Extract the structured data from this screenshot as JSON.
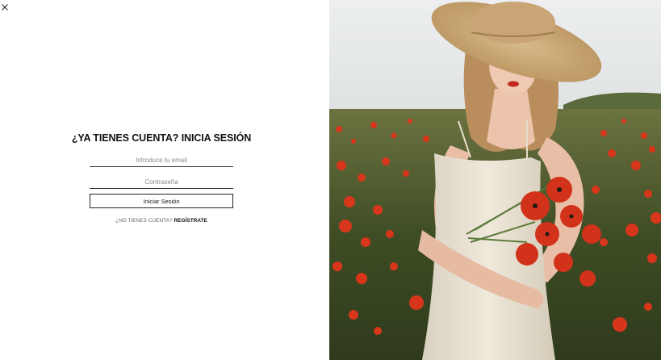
{
  "close": {
    "icon": "close-icon"
  },
  "login": {
    "title": "¿YA TIENES CUENTA? INICIA SESIÓN",
    "email_placeholder": "Introduce tu email",
    "password_placeholder": "Contraseña",
    "submit_label": "Iniciar Sesión",
    "no_account_text": "¿NO TIENES CUENTA?",
    "register_link": "REGÍSTRATE"
  },
  "hero": {
    "image": "woman-in-poppy-field-photo"
  },
  "colors": {
    "poppy_red": "#d8361b",
    "field_green": "#4a5a2a",
    "sky": "#e9ebee",
    "dress": "#ece5d6",
    "hat": "#c9a877"
  }
}
